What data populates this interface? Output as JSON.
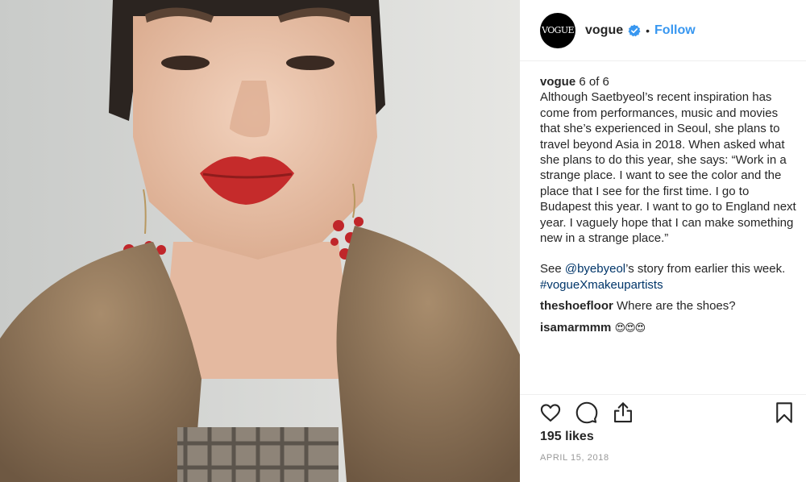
{
  "post": {
    "photo_alt": "Portrait of a woman with red lipstick, red berry earrings and a fur collar"
  },
  "header": {
    "avatar_text": "VOGUE",
    "username": "vogue",
    "separator": "•",
    "follow_label": "Follow",
    "verified_color": "#3897f0"
  },
  "caption": {
    "username": "vogue",
    "counter": "6 of 6",
    "text": "Although Saetbyeol’s recent inspiration has come from performances, music and movies that she’s experienced in Seoul, she plans to travel beyond Asia in 2018. When asked what she plans to do this year, she says: “Work in a strange place. I want to see the color and the place that I see for the first time. I go to Budapest this year. I want to go to England next year. I vaguely hope that I can make something new in a strange place.”",
    "see_prefix": "See ",
    "mention": "@byebyeol",
    "see_suffix": "’s story from earlier this week. ",
    "hashtag": "#vogueXmakeupartists"
  },
  "comments": [
    {
      "username": "theshoefloor",
      "text": "Where are the shoes?"
    },
    {
      "username": "isamarmmm",
      "text": "😍😍😍"
    }
  ],
  "actions": {
    "icons": [
      "heart-icon",
      "comment-icon",
      "share-icon",
      "bookmark-icon"
    ]
  },
  "likes": "195 likes",
  "date": "APRIL 15, 2018"
}
